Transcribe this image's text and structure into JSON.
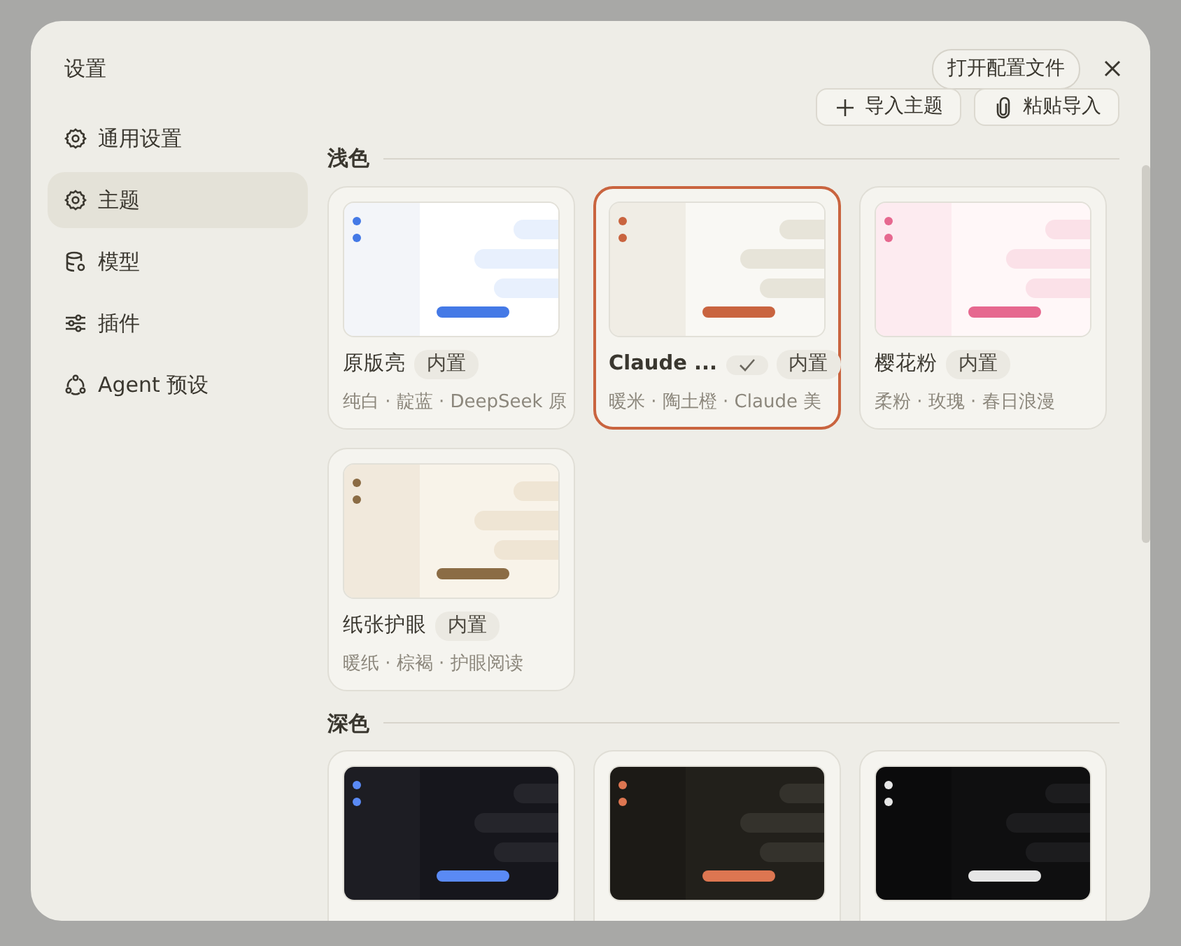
{
  "dialog": {
    "title": "设置",
    "open_config_button": "打开配置文件"
  },
  "sidebar": {
    "items": [
      {
        "label": "通用设置",
        "selected": false
      },
      {
        "label": "主题",
        "selected": true
      },
      {
        "label": "模型",
        "selected": false
      },
      {
        "label": "插件",
        "selected": false
      },
      {
        "label": "Agent 预设",
        "selected": false
      }
    ]
  },
  "toolbar": {
    "buttons": [
      {
        "label": "导入主题"
      },
      {
        "label": "粘贴导入"
      }
    ]
  },
  "sections": [
    {
      "title": "浅色",
      "themes": [
        {
          "name": "原版亮",
          "badge": "内置",
          "description": "纯白 · 靛蓝 · DeepSeek 原",
          "selected": false,
          "color": "#4479e6"
        },
        {
          "name": "Claude ...",
          "badge": "内置",
          "description": "暖米 · 陶土橙 · Claude 美",
          "selected": true,
          "color": "#c9643f"
        },
        {
          "name": "樱花粉",
          "badge": "内置",
          "description": "柔粉 · 玫瑰 · 春日浪漫",
          "selected": false,
          "color": "#e6688f"
        },
        {
          "name": "纸张护眼",
          "badge": "内置",
          "description": "暖纸 · 棕褐 · 护眼阅读",
          "selected": false,
          "color": "#8b6c45"
        }
      ]
    },
    {
      "title": "深色",
      "themes": [
        {
          "selected": false,
          "color": "#5a8af5"
        },
        {
          "selected": false,
          "color": "#dd7651"
        },
        {
          "selected": false,
          "color": "#e6e6e6"
        }
      ]
    }
  ]
}
